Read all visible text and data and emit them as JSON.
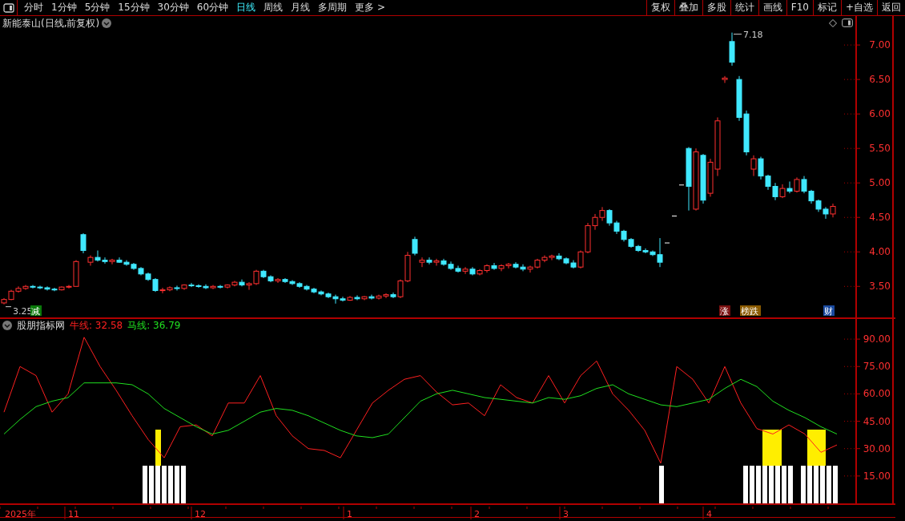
{
  "toolbar": {
    "periods": [
      {
        "label": "分时",
        "selected": false
      },
      {
        "label": "1分钟",
        "selected": false
      },
      {
        "label": "5分钟",
        "selected": false
      },
      {
        "label": "15分钟",
        "selected": false
      },
      {
        "label": "30分钟",
        "selected": false
      },
      {
        "label": "60分钟",
        "selected": false
      },
      {
        "label": "日线",
        "selected": true
      },
      {
        "label": "周线",
        "selected": false
      },
      {
        "label": "月线",
        "selected": false
      },
      {
        "label": "多周期",
        "selected": false
      },
      {
        "label": "更多 >",
        "selected": false
      }
    ],
    "buttons": [
      "复权",
      "叠加",
      "多股",
      "统计",
      "画线",
      "F10",
      "标记",
      "+自选",
      "返回"
    ]
  },
  "price_chart": {
    "title": "新能泰山(日线,前复权)",
    "high_label": "7.18",
    "low_label": "3.25",
    "markers": [
      {
        "text": "减",
        "color": "#0a7a0a"
      },
      {
        "text": "涨",
        "color": "#7a1010"
      },
      {
        "text": "榜跌",
        "color": "#8a5a00"
      },
      {
        "text": "财",
        "color": "#1a4aa0"
      }
    ],
    "chart_data": {
      "type": "candlestick",
      "ylim": [
        3.05,
        7.42
      ],
      "yticks": [
        {
          "value": 7,
          "label": "7.00"
        },
        {
          "value": 6.5,
          "label": "6.50"
        },
        {
          "value": 6,
          "label": "6.00"
        },
        {
          "value": 5.5,
          "label": "5.50"
        },
        {
          "value": 5,
          "label": "5.00"
        },
        {
          "value": 4.5,
          "label": "4.50"
        },
        {
          "value": 4,
          "label": "4.00"
        },
        {
          "value": 3.5,
          "label": "3.50"
        }
      ],
      "ohlc": [
        [
          3.26,
          3.33,
          3.24,
          3.31
        ],
        [
          3.31,
          3.45,
          3.3,
          3.43
        ],
        [
          3.43,
          3.5,
          3.41,
          3.47
        ],
        [
          3.47,
          3.52,
          3.45,
          3.5
        ],
        [
          3.5,
          3.52,
          3.47,
          3.49
        ],
        [
          3.49,
          3.51,
          3.46,
          3.48
        ],
        [
          3.48,
          3.5,
          3.44,
          3.46
        ],
        [
          3.46,
          3.48,
          3.43,
          3.45
        ],
        [
          3.45,
          3.5,
          3.44,
          3.49
        ],
        [
          3.49,
          3.52,
          3.47,
          3.5
        ],
        [
          3.5,
          3.88,
          3.5,
          3.86
        ],
        [
          4.25,
          4.27,
          3.98,
          4.02
        ],
        [
          3.85,
          3.95,
          3.8,
          3.92
        ],
        [
          3.92,
          4.02,
          3.86,
          3.88
        ],
        [
          3.88,
          3.92,
          3.83,
          3.86
        ],
        [
          3.86,
          3.9,
          3.82,
          3.88
        ],
        [
          3.88,
          3.92,
          3.84,
          3.85
        ],
        [
          3.85,
          3.88,
          3.8,
          3.82
        ],
        [
          3.82,
          3.84,
          3.74,
          3.76
        ],
        [
          3.76,
          3.78,
          3.66,
          3.68
        ],
        [
          3.68,
          3.7,
          3.58,
          3.6
        ],
        [
          3.6,
          3.62,
          3.42,
          3.44
        ],
        [
          3.44,
          3.48,
          3.4,
          3.45
        ],
        [
          3.45,
          3.5,
          3.43,
          3.48
        ],
        [
          3.48,
          3.51,
          3.44,
          3.47
        ],
        [
          3.47,
          3.53,
          3.45,
          3.52
        ],
        [
          3.52,
          3.55,
          3.49,
          3.51
        ],
        [
          3.51,
          3.53,
          3.48,
          3.5
        ],
        [
          3.5,
          3.53,
          3.46,
          3.48
        ],
        [
          3.48,
          3.52,
          3.46,
          3.5
        ],
        [
          3.5,
          3.52,
          3.47,
          3.49
        ],
        [
          3.49,
          3.53,
          3.47,
          3.52
        ],
        [
          3.52,
          3.58,
          3.5,
          3.56
        ],
        [
          3.56,
          3.6,
          3.5,
          3.52
        ],
        [
          3.52,
          3.56,
          3.45,
          3.54
        ],
        [
          3.54,
          3.74,
          3.52,
          3.72
        ],
        [
          3.72,
          3.74,
          3.62,
          3.64
        ],
        [
          3.64,
          3.66,
          3.56,
          3.58
        ],
        [
          3.58,
          3.62,
          3.55,
          3.6
        ],
        [
          3.6,
          3.62,
          3.55,
          3.57
        ],
        [
          3.57,
          3.59,
          3.52,
          3.54
        ],
        [
          3.54,
          3.56,
          3.48,
          3.5
        ],
        [
          3.5,
          3.52,
          3.44,
          3.46
        ],
        [
          3.46,
          3.48,
          3.4,
          3.42
        ],
        [
          3.42,
          3.44,
          3.37,
          3.39
        ],
        [
          3.39,
          3.41,
          3.33,
          3.35
        ],
        [
          3.35,
          3.38,
          3.25,
          3.32
        ],
        [
          3.32,
          3.35,
          3.28,
          3.3
        ],
        [
          3.3,
          3.36,
          3.29,
          3.34
        ],
        [
          3.34,
          3.37,
          3.3,
          3.32
        ],
        [
          3.32,
          3.36,
          3.3,
          3.35
        ],
        [
          3.35,
          3.38,
          3.31,
          3.33
        ],
        [
          3.33,
          3.38,
          3.31,
          3.36
        ],
        [
          3.36,
          3.4,
          3.33,
          3.38
        ],
        [
          3.38,
          3.41,
          3.33,
          3.35
        ],
        [
          3.35,
          3.6,
          3.33,
          3.58
        ],
        [
          3.58,
          4.0,
          3.56,
          3.95
        ],
        [
          4.18,
          4.22,
          3.95,
          3.98
        ],
        [
          3.85,
          3.92,
          3.78,
          3.88
        ],
        [
          3.88,
          3.92,
          3.82,
          3.85
        ],
        [
          3.85,
          3.9,
          3.8,
          3.87
        ],
        [
          3.87,
          3.9,
          3.8,
          3.82
        ],
        [
          3.82,
          3.86,
          3.74,
          3.76
        ],
        [
          3.76,
          3.8,
          3.7,
          3.72
        ],
        [
          3.72,
          3.78,
          3.68,
          3.75
        ],
        [
          3.75,
          3.78,
          3.66,
          3.68
        ],
        [
          3.68,
          3.75,
          3.66,
          3.73
        ],
        [
          3.73,
          3.82,
          3.7,
          3.8
        ],
        [
          3.8,
          3.84,
          3.74,
          3.76
        ],
        [
          3.76,
          3.82,
          3.72,
          3.8
        ],
        [
          3.8,
          3.84,
          3.76,
          3.82
        ],
        [
          3.82,
          3.85,
          3.76,
          3.78
        ],
        [
          3.78,
          3.82,
          3.72,
          3.75
        ],
        [
          3.75,
          3.8,
          3.7,
          3.78
        ],
        [
          3.78,
          3.9,
          3.76,
          3.88
        ],
        [
          3.88,
          3.95,
          3.85,
          3.92
        ],
        [
          3.92,
          3.96,
          3.88,
          3.94
        ],
        [
          3.94,
          3.98,
          3.88,
          3.9
        ],
        [
          3.9,
          3.92,
          3.82,
          3.84
        ],
        [
          3.84,
          3.88,
          3.76,
          3.78
        ],
        [
          3.78,
          4.02,
          3.76,
          4.0
        ],
        [
          4.0,
          4.42,
          3.98,
          4.38
        ],
        [
          4.38,
          4.55,
          4.32,
          4.5
        ],
        [
          4.5,
          4.65,
          4.45,
          4.6
        ],
        [
          4.6,
          4.62,
          4.38,
          4.42
        ],
        [
          4.42,
          4.45,
          4.26,
          4.3
        ],
        [
          4.3,
          4.32,
          4.15,
          4.18
        ],
        [
          4.18,
          4.2,
          4.06,
          4.08
        ],
        [
          4.08,
          4.1,
          4.0,
          4.02
        ],
        [
          4.02,
          4.05,
          3.98,
          4.0
        ],
        [
          4.0,
          4.02,
          3.94,
          3.96
        ],
        [
          3.96,
          4.2,
          3.78,
          3.85
        ],
        [
          4.13,
          4.13,
          4.13,
          4.13
        ],
        [
          4.52,
          4.52,
          4.52,
          4.52
        ],
        [
          4.97,
          4.97,
          4.97,
          4.97
        ],
        [
          5.5,
          5.52,
          4.6,
          4.95
        ],
        [
          4.62,
          5.5,
          4.6,
          5.45
        ],
        [
          5.4,
          5.42,
          4.7,
          4.75
        ],
        [
          4.85,
          5.35,
          4.8,
          5.3
        ],
        [
          5.2,
          5.95,
          5.1,
          5.9
        ],
        [
          6.5,
          6.55,
          6.45,
          6.52
        ],
        [
          7.05,
          7.18,
          6.7,
          6.75
        ],
        [
          6.5,
          6.55,
          5.9,
          5.95
        ],
        [
          6.0,
          6.05,
          5.4,
          5.45
        ],
        [
          5.2,
          5.4,
          5.1,
          5.35
        ],
        [
          5.35,
          5.38,
          5.05,
          5.1
        ],
        [
          5.1,
          5.12,
          4.9,
          4.95
        ],
        [
          4.95,
          5.0,
          4.75,
          4.8
        ],
        [
          4.8,
          4.98,
          4.78,
          4.92
        ],
        [
          4.92,
          5.02,
          4.85,
          4.88
        ],
        [
          4.88,
          5.08,
          4.86,
          5.05
        ],
        [
          5.05,
          5.1,
          4.85,
          4.88
        ],
        [
          4.88,
          4.9,
          4.7,
          4.74
        ],
        [
          4.74,
          4.76,
          4.58,
          4.62
        ],
        [
          4.62,
          4.65,
          4.48,
          4.55
        ],
        [
          4.55,
          4.7,
          4.5,
          4.66
        ]
      ]
    }
  },
  "indicator": {
    "name": "股朋指标网",
    "legend": [
      ": 32.58",
      ": 36.79"
    ],
    "chart_data": {
      "type": "line",
      "ylim": [
        0,
        94
      ],
      "yticks": [
        {
          "value": 90,
          "label": "90.00"
        },
        {
          "value": 75,
          "label": "75.00"
        },
        {
          "value": 60,
          "label": "60.00"
        },
        {
          "value": 45,
          "label": "45.00"
        },
        {
          "value": 30,
          "label": "30.00"
        },
        {
          "value": 15,
          "label": "15.00"
        }
      ],
      "series": [
        {
          "name": "牛线",
          "color": "#ff2020",
          "values": [
            50,
            75,
            70,
            50,
            60,
            91,
            75,
            62,
            48,
            35,
            25,
            42,
            43,
            37,
            55,
            55,
            70,
            48,
            37,
            30,
            29,
            25,
            40,
            55,
            62,
            68,
            70,
            61,
            54,
            55,
            48,
            65,
            58,
            55,
            70,
            55,
            70,
            78,
            60,
            51,
            40,
            22,
            75,
            68,
            55,
            75,
            55,
            41,
            38,
            43,
            38,
            28,
            32
          ]
        },
        {
          "name": "马线",
          "color": "#20e020",
          "values": [
            38,
            46,
            53,
            56,
            58,
            66,
            66,
            66,
            65,
            60,
            52,
            47,
            42,
            38,
            40,
            45,
            50,
            52,
            51,
            48,
            44,
            40,
            37,
            36,
            38,
            47,
            56,
            60,
            62,
            60,
            58,
            57,
            56,
            55,
            58,
            57,
            59,
            63,
            65,
            60,
            57,
            54,
            53,
            55,
            57,
            63,
            68,
            64,
            56,
            51,
            47,
            42,
            38
          ]
        }
      ]
    }
  },
  "date_axis": [
    "2025年",
    "11",
    "12",
    "1",
    "2",
    "3",
    "4"
  ]
}
